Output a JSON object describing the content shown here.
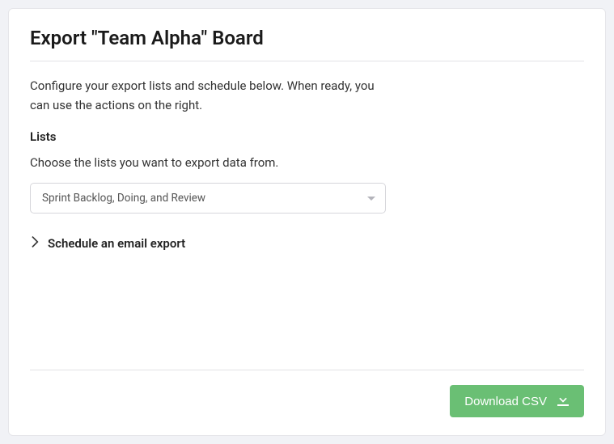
{
  "title": "Export \"Team Alpha\" Board",
  "intro": "Configure your export lists and schedule below. When ready, you can use the actions on the right.",
  "lists": {
    "label": "Lists",
    "description": "Choose the lists you want to export data from.",
    "selected": "Sprint Backlog, Doing, and Review"
  },
  "schedule": {
    "label": "Schedule an email export"
  },
  "actions": {
    "download": "Download CSV"
  }
}
